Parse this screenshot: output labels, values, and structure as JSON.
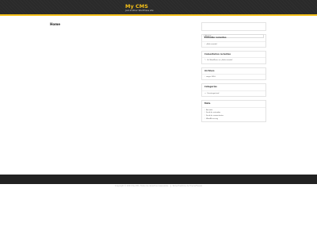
{
  "header": {
    "site_title": "My CMS",
    "tagline": "Just another WordPress site"
  },
  "main": {
    "page_title": "Home"
  },
  "sidebar": {
    "search_placeholder": "Buscar …",
    "recent_posts": {
      "title": "Entradas recientes",
      "items": [
        "¡Hola mundo!"
      ]
    },
    "recent_comments": {
      "title": "Comentarios recientes",
      "items": [
        "Un WordPress en ¡Hola mundo!"
      ]
    },
    "archives": {
      "title": "Archivos",
      "items": [
        "mayo 2016"
      ]
    },
    "categories": {
      "title": "Categorías",
      "items": [
        "Uncategorized"
      ]
    },
    "meta": {
      "title": "Meta",
      "items": [
        "Acceder",
        "Feed de entradas",
        "Feed de comentarios",
        "WordPress.org"
      ]
    }
  },
  "footer": {
    "copyright": "Copyright © 2023 My CMS. Todos los derechos reservados.",
    "credit": "Tema Freshline de ThemeFreesia"
  },
  "colors": {
    "accent": "#f4c019",
    "header_bg": "#2a2a2a",
    "footer_bg": "#222222"
  }
}
